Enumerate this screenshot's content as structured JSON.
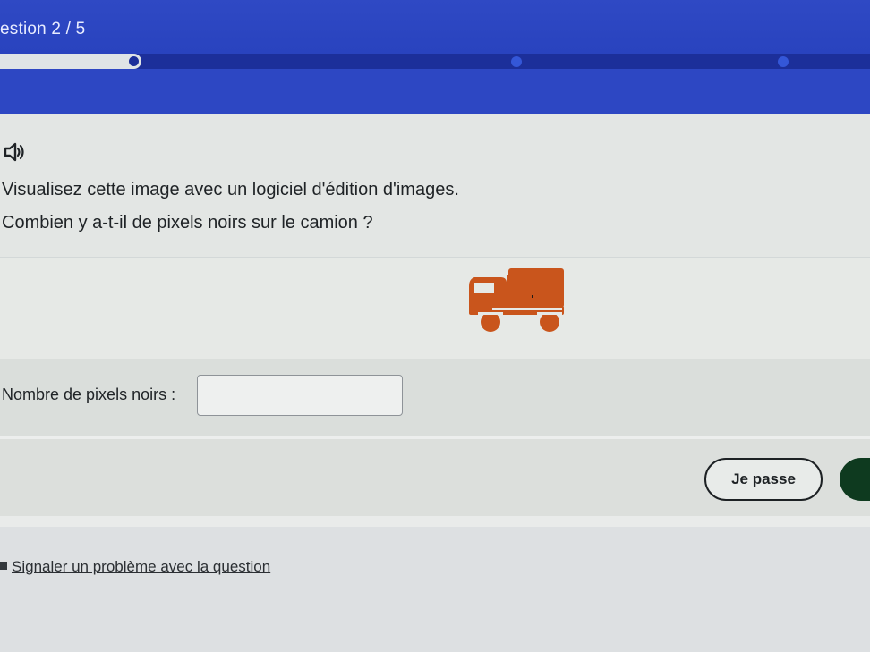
{
  "header": {
    "question_counter": "estion 2 / 5",
    "progress": {
      "current": 2,
      "total": 5
    }
  },
  "question": {
    "audio_icon": "speaker-icon",
    "line1": "Visualisez cette image avec un logiciel d'édition d'images.",
    "line2": "Combien y a-t-il de pixels noirs sur le camion ?",
    "image_icon": "truck-icon",
    "image_color": "#c9551c"
  },
  "answer": {
    "label": "Nombre de pixels noirs :",
    "value": "",
    "placeholder": ""
  },
  "actions": {
    "skip_label": "Je passe",
    "validate_color": "#0e3a1f"
  },
  "footer": {
    "report_link": "Signaler un problème avec la question"
  },
  "colors": {
    "header_blue": "#2d47c3",
    "progress_track": "#1c2f9a",
    "background": "#e3e6e4",
    "text": "#1f2326"
  }
}
